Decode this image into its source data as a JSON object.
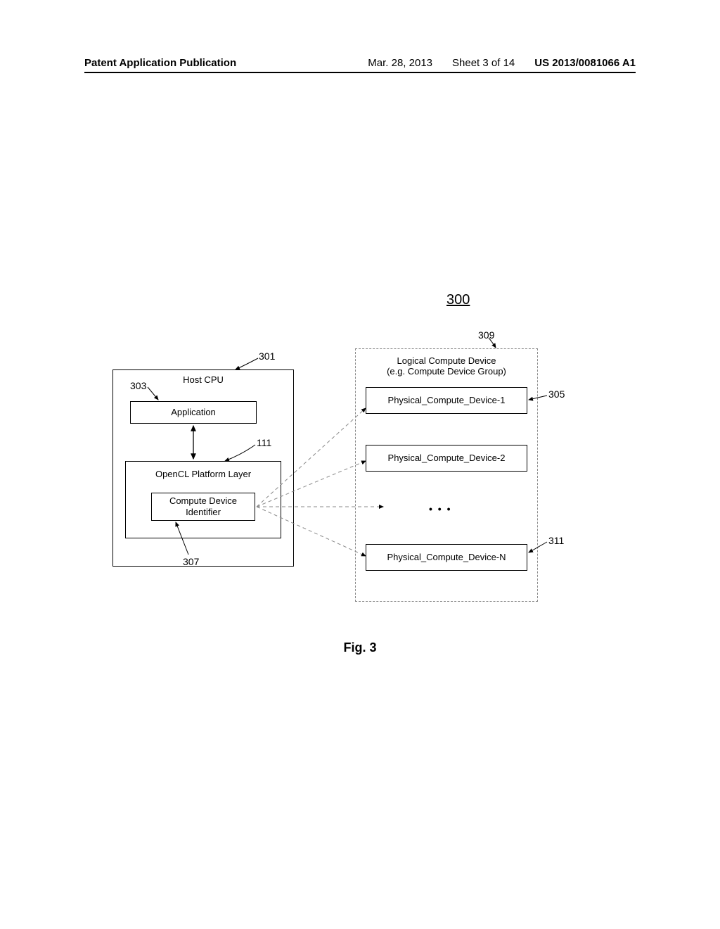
{
  "header": {
    "publication": "Patent Application Publication",
    "date": "Mar. 28, 2013",
    "sheet": "Sheet 3 of 14",
    "appnum": "US 2013/0081066 A1"
  },
  "figure": {
    "num": "300",
    "caption": "Fig. 3"
  },
  "refs": {
    "r301": "301",
    "r303": "303",
    "r305": "305",
    "r307": "307",
    "r309": "309",
    "r311": "311",
    "r111": "111"
  },
  "boxes": {
    "host_cpu": "Host CPU",
    "application": "Application",
    "platform_layer": "OpenCL Platform Layer",
    "compute_id": "Compute Device Identifier",
    "logical_group_l1": "Logical Compute Device",
    "logical_group_l2": "(e.g. Compute Device Group)",
    "pcd1": "Physical_Compute_Device-1",
    "pcd2": "Physical_Compute_Device-2",
    "pcdn": "Physical_Compute_Device-N",
    "ellipsis": "• • •"
  }
}
